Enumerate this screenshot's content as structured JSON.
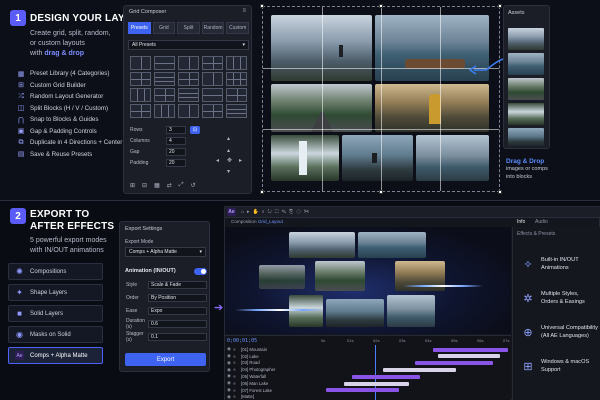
{
  "colors": {
    "accent": "#5b5bf7",
    "blue": "#3d63f0",
    "bar_purple": "#8a55e6",
    "bar_light": "#d8d3e8",
    "background": "#0c0f18"
  },
  "section1": {
    "number": "1",
    "title": "DESIGN YOUR LAYOUT",
    "subtitle_line1": "Create grid, split, random,",
    "subtitle_line2": "or custom layouts",
    "subtitle_with": "with",
    "subtitle_highlight": "drag & drop",
    "features": [
      {
        "icon": "grid-icon",
        "label": "Preset Library (4 Categories)"
      },
      {
        "icon": "layout-icon",
        "label": "Custom Grid Builder"
      },
      {
        "icon": "shuffle-icon",
        "label": "Random Layout Generator"
      },
      {
        "icon": "split-icon",
        "label": "Split Blocks (H / V / Custom)"
      },
      {
        "icon": "magnet-icon",
        "label": "Snap to Blocks & Guides"
      },
      {
        "icon": "padding-icon",
        "label": "Gap & Padding Controls"
      },
      {
        "icon": "duplicate-icon",
        "label": "Duplicate in 4 Directions + Center"
      },
      {
        "icon": "save-icon",
        "label": "Save & Reuse Presets"
      }
    ],
    "composer": {
      "title": "Grid Composer",
      "tabs": [
        "Presets",
        "Grid",
        "Split",
        "Random",
        "Custom"
      ],
      "active_tab": "Presets",
      "preset_select": "All Presets",
      "fields": [
        {
          "label": "Rows",
          "value": "3"
        },
        {
          "label": "Columns",
          "value": "4"
        },
        {
          "label": "Gap",
          "value": "20"
        },
        {
          "label": "Padding",
          "value": "20"
        }
      ],
      "button": "⊡"
    },
    "assets": {
      "title": "Assets",
      "drag_title": "Drag & Drop",
      "drag_text_line1": "images or comps",
      "drag_text_line2": "into blocks"
    }
  },
  "section2": {
    "number": "2",
    "title_line1": "EXPORT TO",
    "title_line2": "AFTER EFFECTS",
    "subtitle_line1": "5 powerful export modes",
    "subtitle_line2": "with IN/OUT animations",
    "layers": [
      {
        "icon": "star-burst-icon",
        "label": "Compositions"
      },
      {
        "icon": "star-icon",
        "label": "Shape Layers"
      },
      {
        "icon": "square-icon",
        "label": "Solid Layers"
      },
      {
        "icon": "circle-icon",
        "label": "Masks on Solid"
      },
      {
        "icon": "ae-icon",
        "label": "Comps + Alpha Matte"
      }
    ],
    "active_layer": 4,
    "export_panel": {
      "title": "Export Settings",
      "mode_label": "Export Mode",
      "mode_value": "Comps + Alpha Matte",
      "anim_label": "Animation (IN/OUT)",
      "rows": [
        {
          "label": "Style",
          "value": "Scale & Fade"
        },
        {
          "label": "Order",
          "value": "By Position"
        },
        {
          "label": "Ease",
          "value": "Expo"
        },
        {
          "label": "Duration (s)",
          "value": "0.6"
        },
        {
          "label": "Stagger (s)",
          "value": "0.1"
        }
      ],
      "button": "Export"
    },
    "ae": {
      "logo": "Ae",
      "comp_prefix": "Composition",
      "comp_name": "Grid_Layout",
      "timecode": "0;00;01;05",
      "layers": [
        "[01] Mountain",
        "[02] Lake",
        "[03] Road",
        "[04] Photographer",
        "[05] Waterfall",
        "[06] Man Lake",
        "[07] Forest Lake",
        "[Matte]"
      ],
      "ruler": [
        "0s",
        "01s",
        "02s",
        "03s",
        "04s",
        "05s",
        "06s",
        "07s"
      ],
      "info_tab": "Info",
      "audio_tab": "Audio",
      "effects_label": "Effects & Presets"
    },
    "cards": [
      {
        "icon": "sparkle-icon",
        "line1": "Built-in IN/OUT",
        "line2": "Animations"
      },
      {
        "icon": "settings-sparkle-icon",
        "line1": "Multiple Styles,",
        "line2": "Orders & Easings"
      },
      {
        "icon": "globe-icon",
        "line1": "Universal Compatibility",
        "line2": "(All AE Languages)"
      },
      {
        "icon": "windows-icon",
        "line1": "Windows & macOS",
        "line2": "Support"
      }
    ]
  }
}
